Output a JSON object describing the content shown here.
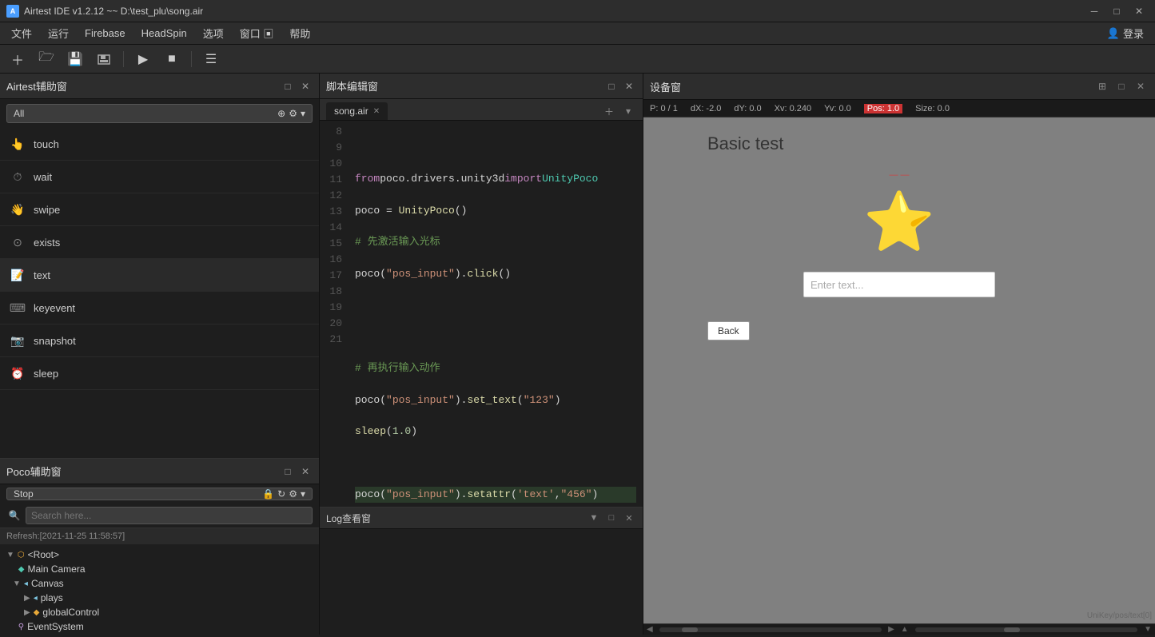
{
  "titlebar": {
    "title": "Airtest IDE v1.2.12 ~~ D:\\test_plu\\song.air",
    "icon_label": "A",
    "minimize": "─",
    "maximize": "□",
    "close": "✕"
  },
  "menubar": {
    "items": [
      "文件",
      "运行",
      "Firebase",
      "HeadSpin",
      "选项",
      "窗口",
      "帮助"
    ],
    "window_icon": "▣",
    "login": "登录"
  },
  "toolbar": {
    "buttons": [
      "＋",
      "📁",
      "💾",
      "💾",
      "▶",
      "■",
      "≡"
    ]
  },
  "airtest_panel": {
    "title": "Airtest辅助窗",
    "dropdown": "All",
    "items": [
      {
        "name": "touch",
        "icon": "👆"
      },
      {
        "name": "wait",
        "icon": "⏱"
      },
      {
        "name": "swipe",
        "icon": "👋"
      },
      {
        "name": "exists",
        "icon": "⊙"
      },
      {
        "name": "text",
        "icon": "📝"
      },
      {
        "name": "keyevent",
        "icon": "⌨"
      },
      {
        "name": "snapshot",
        "icon": "📷"
      },
      {
        "name": "sleep",
        "icon": "⏰"
      }
    ]
  },
  "editor": {
    "title": "脚本编辑窗",
    "tab": "song.air",
    "lines": {
      "8": "",
      "9": "from poco.drivers.unity3d import UnityPoco",
      "10": "poco = UnityPoco()",
      "11": "# 先激活输入光标",
      "12": "poco(\"pos_input\").click()",
      "13": "",
      "14": "",
      "15": "# 再执行输入动作",
      "16": "poco(\"pos_input\").set_text(\"123\")",
      "17": "sleep(1.0)",
      "18": "",
      "19": "poco(\"pos_input\").setattr('text',\"456\")",
      "20": "",
      "21": ""
    },
    "line_numbers": [
      8,
      9,
      10,
      11,
      12,
      13,
      14,
      15,
      16,
      17,
      18,
      19,
      20,
      21
    ]
  },
  "log_panel": {
    "title": "Log查看窗"
  },
  "poco_panel": {
    "title": "Poco辅助窗",
    "dropdown": "Stop",
    "search_placeholder": "Search here...",
    "refresh_label": "Refresh:[2021-11-25 11:58:57]",
    "tree": [
      {
        "level": 0,
        "indent": 0,
        "toggle": "▼",
        "icon": "⬡",
        "icon_class": "root",
        "label": "<Root>"
      },
      {
        "level": 1,
        "indent": 1,
        "toggle": "",
        "icon": "◆",
        "icon_class": "camera",
        "label": "Main Camera"
      },
      {
        "level": 1,
        "indent": 1,
        "toggle": "▼",
        "icon": "◂",
        "icon_class": "canvas",
        "label": "Canvas"
      },
      {
        "level": 2,
        "indent": 2,
        "toggle": "▶",
        "icon": "◂",
        "icon_class": "arrow",
        "label": "plays"
      },
      {
        "level": 2,
        "indent": 2,
        "toggle": "▶",
        "icon": "◆",
        "icon_class": "arrow",
        "label": "globalControl"
      },
      {
        "level": 1,
        "indent": 1,
        "toggle": "",
        "icon": "⚲",
        "icon_class": "camera",
        "label": "EventSystem"
      }
    ]
  },
  "device_panel": {
    "title": "设备窗",
    "status_bar": {
      "p": "P: 0 / 1",
      "dx": "dX: -2.0",
      "dy": "dY: 0.0",
      "xv": "Xv: 0.240",
      "yv": "Yv: 0.0",
      "pos": "Pos: 1.0",
      "size": "Size: 0.0"
    },
    "game": {
      "title": "Basic test",
      "placeholder": "Enter text...",
      "back_button": "Back",
      "watermark": "UniKey/pos/text[0]"
    }
  }
}
